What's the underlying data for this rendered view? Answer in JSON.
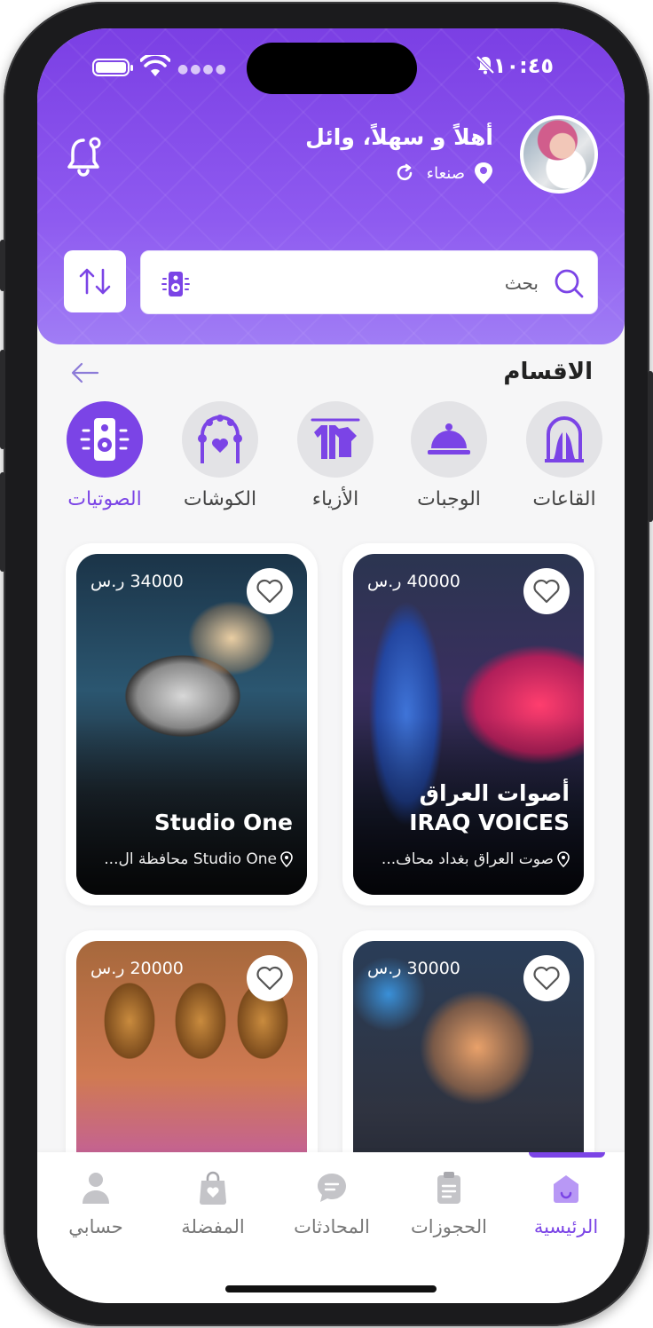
{
  "status_bar": {
    "time": "١٠:٤٥"
  },
  "header": {
    "greeting": "أهلاً و سهلاً، وائل",
    "location": "صنعاء",
    "search": {
      "placeholder": "بحث"
    }
  },
  "categories": {
    "title": "الاقسام",
    "items": [
      {
        "label": "القاعات",
        "icon": "hall-icon"
      },
      {
        "label": "الوجبات",
        "icon": "cloche-icon"
      },
      {
        "label": "الأزياء",
        "icon": "clothes-icon"
      },
      {
        "label": "الكوشات",
        "icon": "wedding-arch-icon"
      },
      {
        "label": "الصوتيات",
        "icon": "speaker-icon",
        "active": true
      }
    ]
  },
  "listings": [
    {
      "price": "40000 ر.س",
      "title": "أصوات العراق IRAQ VOICES",
      "address": "صوت العراق بغداد محاف..."
    },
    {
      "price": "34000 ر.س",
      "title": "Studio One",
      "address": "Studio One محافظة ال..."
    },
    {
      "price": "30000 ر.س",
      "title": "",
      "address": ""
    },
    {
      "price": "20000 ر.س",
      "title": "",
      "address": ""
    }
  ],
  "tabbar": {
    "items": [
      {
        "label": "الرئيسية",
        "active": true
      },
      {
        "label": "الحجوزات"
      },
      {
        "label": "المحادثات"
      },
      {
        "label": "المفضلة"
      },
      {
        "label": "حسابي"
      }
    ]
  },
  "colors": {
    "accent": "#7b44e6",
    "header_top": "#7b3fe4",
    "header_bottom": "#a07df5"
  }
}
